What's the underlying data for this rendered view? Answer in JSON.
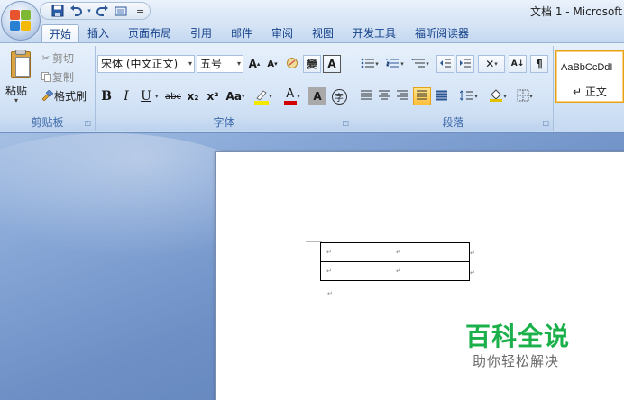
{
  "window": {
    "title": "文档 1 - Microsoft"
  },
  "quick_access": {
    "more_glyph": "="
  },
  "tabs": [
    "开始",
    "插入",
    "页面布局",
    "引用",
    "邮件",
    "审阅",
    "视图",
    "开发工具",
    "福昕阅读器"
  ],
  "clipboard": {
    "paste_label": "粘贴",
    "paste_arrow": "▾",
    "cut_label": "剪切",
    "copy_label": "复制",
    "format_painter_label": "格式刷",
    "group_label": "剪贴板"
  },
  "font": {
    "font_name": "宋体 (中文正文)",
    "font_size": "五号",
    "grow_label": "A",
    "shrink_label": "A",
    "phonetic_label": "變",
    "border_char_label": "A",
    "bold": "B",
    "italic": "I",
    "underline": "U",
    "strike": "abc",
    "subscript": "x₂",
    "superscript": "x²",
    "change_case": "Aa",
    "font_color_label": "A",
    "shade_label": "A",
    "enclose_label": "字",
    "group_label": "字体"
  },
  "paragraph": {
    "group_label": "段落",
    "sort_label": "A↓"
  },
  "styles": {
    "sample": "AaBbCcDdI",
    "normal_label": "↵ 正文"
  },
  "document": {
    "cells": [
      [
        "↵",
        "↵"
      ],
      [
        "↵",
        "↵"
      ]
    ],
    "row_end_marks": [
      "↵",
      "↵"
    ],
    "paragraph_mark": "↵"
  },
  "watermark": {
    "title": "百科全说",
    "subtitle": "助你轻松解决"
  },
  "colors": {
    "highlight": "#f5e800",
    "font_color": "#d40000",
    "watermark_green": "#1ab04a"
  }
}
